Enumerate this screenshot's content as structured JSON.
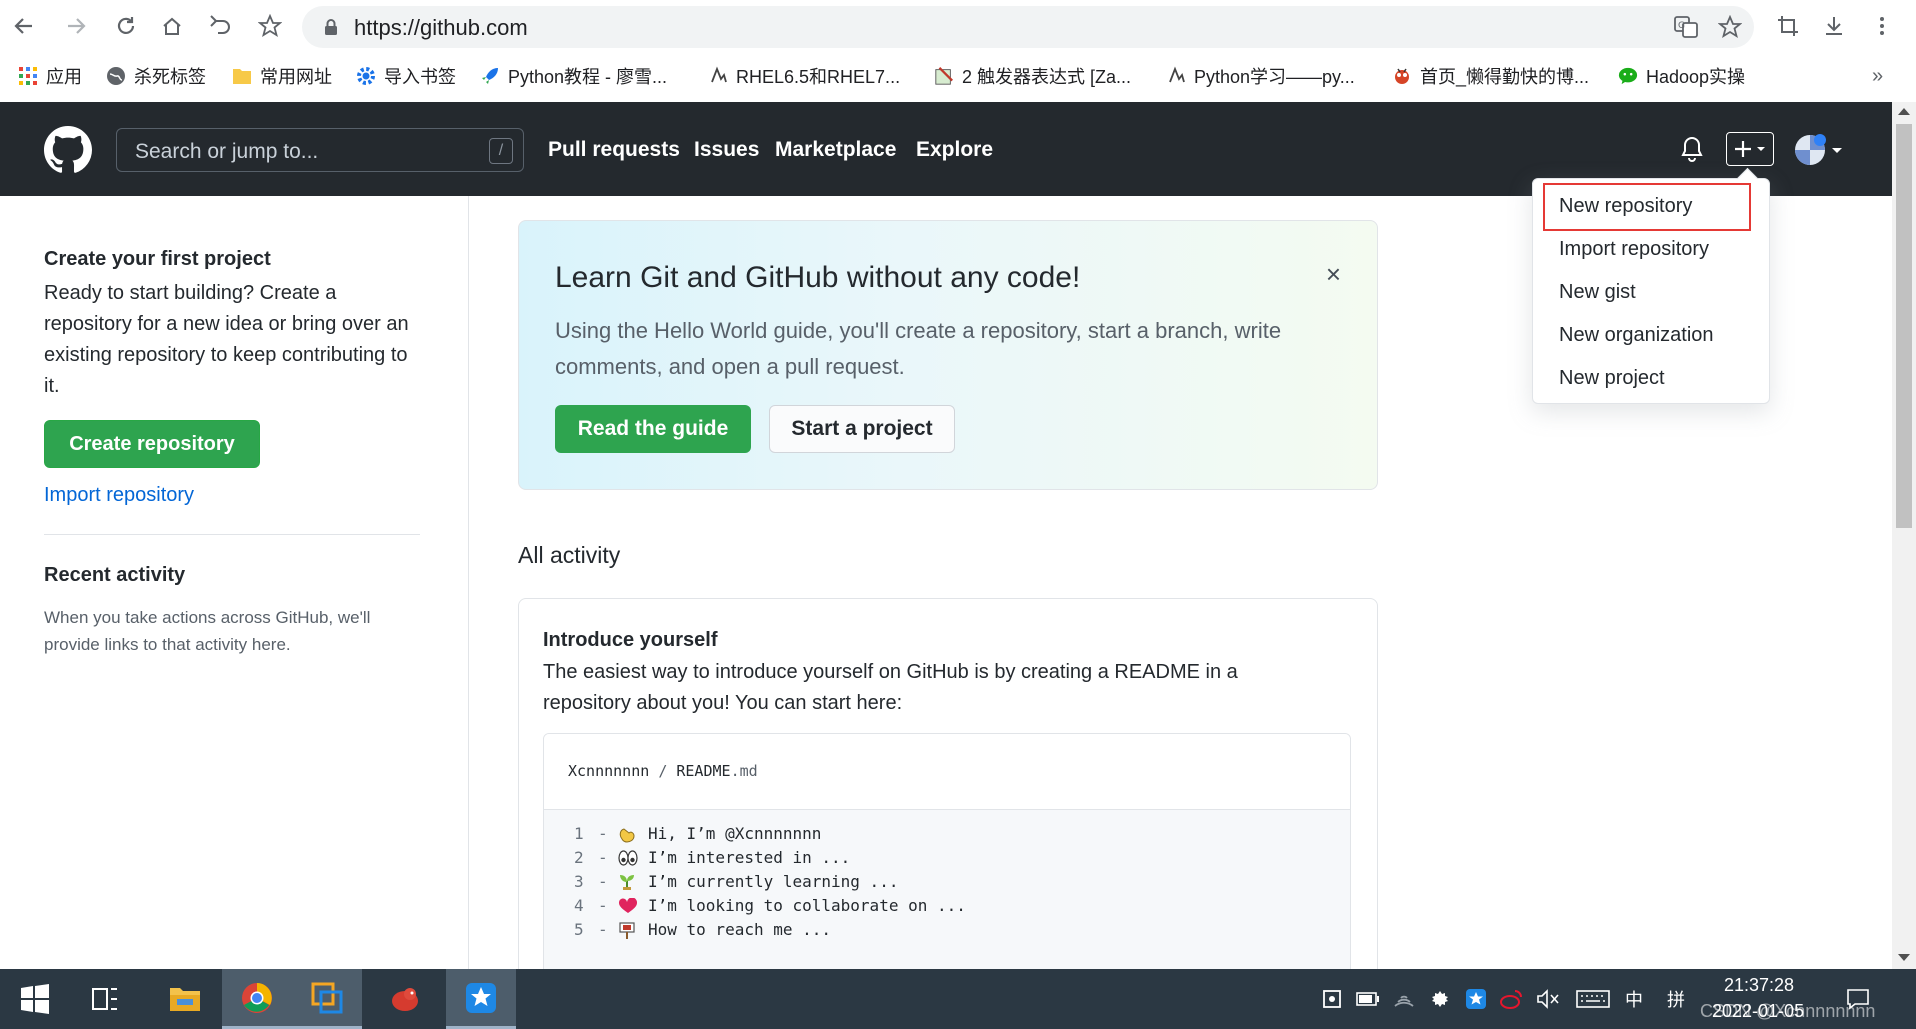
{
  "browser": {
    "url": "https://github.com",
    "bookmarks": [
      {
        "label": "应用",
        "icon": "apps-grid-icon"
      },
      {
        "label": "杀死标签",
        "icon": "globe-icon"
      },
      {
        "label": "常用网址",
        "icon": "folder-icon"
      },
      {
        "label": "导入书签",
        "icon": "gear-icon"
      },
      {
        "label": "Python教程 - 廖雪...",
        "icon": "rocket-icon"
      },
      {
        "label": "RHEL6.5和RHEL7...",
        "icon": "csdn-icon"
      },
      {
        "label": "2 触发器表达式 [Za...",
        "icon": "notepad-icon"
      },
      {
        "label": "Python学习——py...",
        "icon": "csdn-icon"
      },
      {
        "label": "首页_懒得勤快的博...",
        "icon": "bug-icon"
      },
      {
        "label": "Hadoop实操",
        "icon": "wechat-icon"
      }
    ],
    "more": "»"
  },
  "header": {
    "search_placeholder": "Search or jump to...",
    "search_shortcut": "/",
    "nav": [
      "Pull requests",
      "Issues",
      "Marketplace",
      "Explore"
    ]
  },
  "dropdown": {
    "items": [
      "New repository",
      "Import repository",
      "New gist",
      "New organization",
      "New project"
    ]
  },
  "sidebar": {
    "first_project_title": "Create your first project",
    "first_project_desc": "Ready to start building? Create a repository for a new idea or bring over an existing repository to keep contributing to it.",
    "create_button": "Create repository",
    "import_link": "Import repository",
    "recent_title": "Recent activity",
    "recent_desc": "When you take actions across GitHub, we'll provide links to that activity here."
  },
  "banner": {
    "title": "Learn Git and GitHub without any code!",
    "desc": "Using the Hello World guide, you'll create a repository, start a branch, write comments, and open a pull request.",
    "close": "×",
    "read_button": "Read the guide",
    "start_button": "Start a project"
  },
  "activity": {
    "heading": "All activity",
    "intro_title": "Introduce yourself",
    "intro_desc": "The easiest way to introduce yourself on GitHub is by creating a README in a repository about you! You can start here:",
    "readme_user": "Xcnnnnnnn",
    "readme_sep": "/",
    "readme_file": "README",
    "readme_ext": ".md",
    "lines": [
      {
        "num": "1",
        "dash": "-",
        "emoji": "wave-emoji",
        "text": "Hi, I’m @Xcnnnnnnn"
      },
      {
        "num": "2",
        "dash": "-",
        "emoji": "eyes-emoji",
        "text": "I’m interested in ..."
      },
      {
        "num": "3",
        "dash": "-",
        "emoji": "seedling-emoji",
        "text": "I’m currently learning ..."
      },
      {
        "num": "4",
        "dash": "-",
        "emoji": "heart-emoji",
        "text": "I’m looking to collaborate on ..."
      },
      {
        "num": "5",
        "dash": "-",
        "emoji": "mailbox-emoji",
        "text": "How to reach me ..."
      }
    ]
  },
  "taskbar": {
    "time": "21:37:28",
    "date": "2022-01-05",
    "ime": "中",
    "ime_mode": "拼",
    "watermark": "CSDN @Xcnnnnnnnn"
  },
  "colors": {
    "github_header": "#24292e",
    "primary_green": "#2ea44f",
    "link_blue": "#0366d6",
    "highlight_red": "#e53935"
  }
}
